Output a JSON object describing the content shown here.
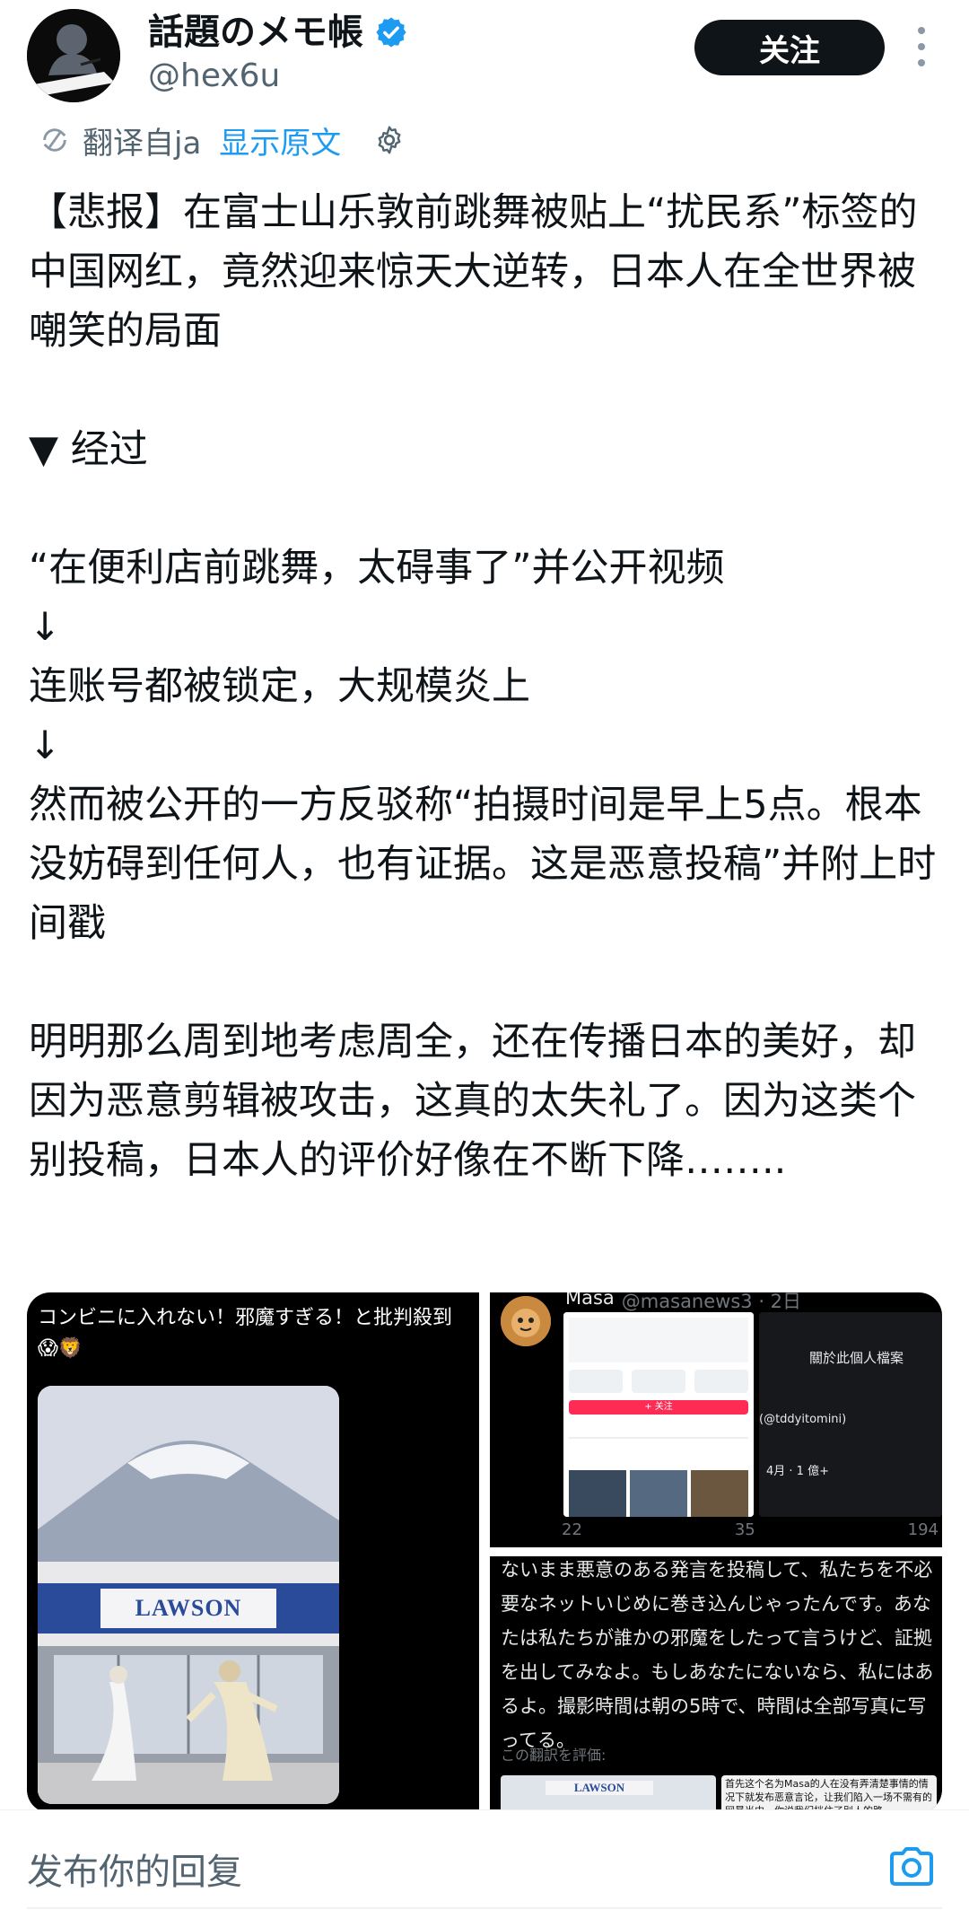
{
  "author": {
    "display_name": "話題のメモ帳",
    "handle": "@hex6u",
    "verified_icon": "verified-badge-icon"
  },
  "follow_label": "关注",
  "translate": {
    "label": "翻译自ja",
    "show_original": "显示原文"
  },
  "tweet_text": "【悲报】在富士山乐敦前跳舞被贴上“扰民系”标签的中国网红，竟然迎来惊天大逆转，日本人在全世界被嘲笑的局面\n\n▼ 经过\n\n“在便利店前跳舞，太碍事了”并公开视频\n↓\n连账号都被锁定，大规模炎上\n↓\n然而被公开的一方反驳称“拍摄时间是早上5点。根本没妨碍到任何人，也有证据。这是恶意投稿”并附上时间戳\n\n明明那么周到地考虑周全，还在传播日本的美好，却因为恶意剪辑被攻击，这真的太失礼了。因为这类个别投稿，日本人的评价好像在不断下降……..",
  "media": {
    "left_caption": "コンビニに入れない！邪魔すぎる！と批判殺到😱🦁",
    "store_sign": "LAWSON",
    "quoted_name": "Masa",
    "quoted_handle": "@masanews3 · 2日",
    "panel_title": "關於此個人檔案",
    "panel_line1": "(@tddyitomini)",
    "panel_line2": "4月 · 1 億+",
    "follow_chip": "+ 关注",
    "stats": [
      "22",
      "35",
      "194"
    ],
    "bottom_text": "ないまま悪意のある発言を投稿して、私たちを不必要なネットいじめに巻き込んじゃったんです。あなたは私たちが誰かの邪魔をしたって言うけど、証拠を出してみなよ。もしあなたにないなら、私にはあるよ。撮影時間は朝の5時で、時間は全部写真に写ってる。",
    "eval_label": "この翻訳を評価:",
    "mini_store_sign": "LAWSON",
    "mini_cn_text": "首先这个名为Masa的人在没有弄清楚事情的情况下就发布恶意言论，让我们陷入一场不需有的网暴当中，你说我们挡住了别人的路"
  },
  "reply": {
    "placeholder": "发布你的回复",
    "camera_icon": "camera-icon"
  },
  "colors": {
    "accent": "#1d9bf0",
    "text": "#0f1419",
    "secondary": "#536471"
  }
}
